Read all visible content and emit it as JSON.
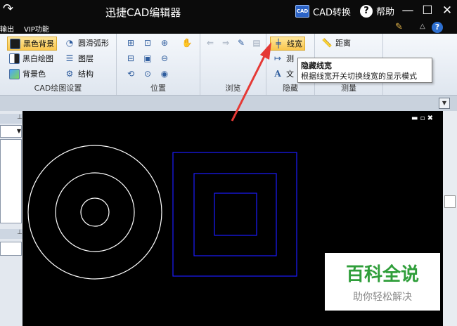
{
  "titlebar": {
    "title": "迅捷CAD编辑器",
    "cad_convert": "CAD转换",
    "cad_icon_text": "CAD",
    "help": "帮助",
    "minimize_glyph": "—",
    "maximize_glyph": "☐",
    "close_glyph": "✕",
    "redo_glyph": "↷"
  },
  "menu": {
    "output": "输出",
    "vip": "VIP功能"
  },
  "ribbon": {
    "groups": {
      "draw_settings": {
        "label": "CAD绘图设置",
        "black_bg": "黑色背景",
        "smooth_arc": "圆滑弧形",
        "bw_draw": "黑白绘图",
        "layers": "图层",
        "bg_color": "背景色",
        "structure": "结构"
      },
      "position": {
        "label": "位置"
      },
      "browse": {
        "label": "浏览"
      },
      "hide": {
        "label": "隐藏",
        "line_width": "线宽",
        "measure": "测",
        "text": "文"
      },
      "measure": {
        "label": "测量",
        "distance": "距离"
      }
    },
    "tooltip": {
      "title": "隐藏线宽",
      "desc": "根据线宽开关切换线宽的显示模式"
    }
  },
  "colors": {
    "accent": "#f9c64d",
    "arrow": "#e53935",
    "circle": "#ffffff",
    "square": "#1a1aff",
    "watermark": "#2f9e3a"
  },
  "watermark": {
    "line1": "百科全说",
    "line2": "助你轻松解决"
  }
}
